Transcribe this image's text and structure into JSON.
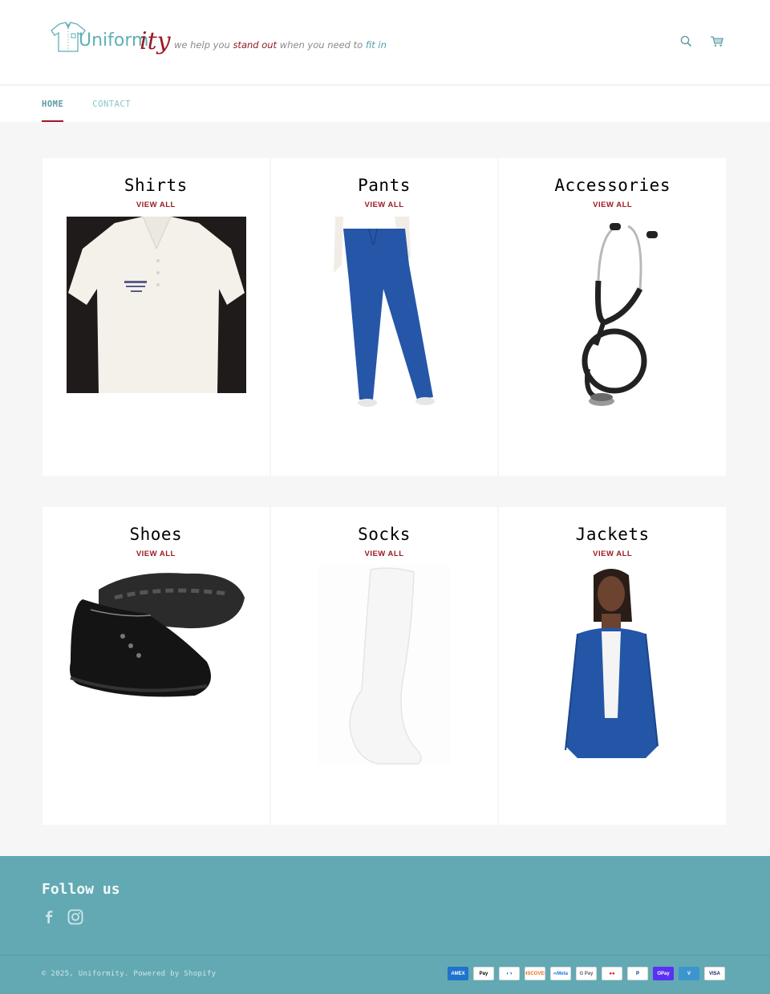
{
  "header": {
    "logo": {
      "word": "Uniform",
      "word_suffix": "ity",
      "tagline_parts": [
        "we help you ",
        "stand out",
        " when you need to ",
        "fit in"
      ]
    },
    "icons": {
      "search": "search-icon",
      "cart": "cart-icon"
    }
  },
  "nav": {
    "items": [
      {
        "label": "HOME",
        "active": true
      },
      {
        "label": "CONTACT",
        "active": false
      }
    ]
  },
  "collections": [
    {
      "title": "Shirts",
      "link_label": "VIEW ALL",
      "image": "white polo shirt"
    },
    {
      "title": "Pants",
      "link_label": "VIEW ALL",
      "image": "royal blue scrub pants"
    },
    {
      "title": "Accessories",
      "link_label": "VIEW ALL",
      "image": "black stethoscope"
    },
    {
      "title": "Shoes",
      "link_label": "VIEW ALL",
      "image": "black leather nursing shoes"
    },
    {
      "title": "Socks",
      "link_label": "VIEW ALL",
      "image": "white compression sock"
    },
    {
      "title": "Jackets",
      "link_label": "VIEW ALL",
      "image": "royal blue scrub jacket"
    }
  ],
  "footer": {
    "title": "Follow us",
    "social": [
      "facebook-icon",
      "instagram-icon"
    ],
    "copyright": "© 2025, Uniformity. Powered by Shopify",
    "payments": [
      {
        "name": "American Express",
        "label": "AMEX",
        "bg": "#1f72cd",
        "fg": "#ffffff"
      },
      {
        "name": "Apple Pay",
        "label": " Pay",
        "bg": "#ffffff",
        "fg": "#000000"
      },
      {
        "name": "Diners Club",
        "label": "◐◑",
        "bg": "#ffffff",
        "fg": "#0079be"
      },
      {
        "name": "Discover",
        "label": "DISCOVER",
        "bg": "#ffffff",
        "fg": "#e96c1f"
      },
      {
        "name": "Meta Pay",
        "label": "∞Meta",
        "bg": "#ffffff",
        "fg": "#1877f2"
      },
      {
        "name": "Google Pay",
        "label": "G Pay",
        "bg": "#ffffff",
        "fg": "#5f6368"
      },
      {
        "name": "Mastercard",
        "label": "●●",
        "bg": "#ffffff",
        "fg": "#eb001b"
      },
      {
        "name": "PayPal",
        "label": "P",
        "bg": "#ffffff",
        "fg": "#003087"
      },
      {
        "name": "Shop Pay",
        "label": "OPay",
        "bg": "#5a31f4",
        "fg": "#ffffff"
      },
      {
        "name": "Venmo",
        "label": "V",
        "bg": "#3d95ce",
        "fg": "#ffffff"
      },
      {
        "name": "Visa",
        "label": "VISA",
        "bg": "#ffffff",
        "fg": "#1a1f71"
      }
    ]
  },
  "colors": {
    "accent_red": "#9b1a24",
    "teal": "#62a9b3",
    "nav_active": "#5b9aa4",
    "nav_inactive": "#8cc3ca",
    "page_bg": "#f6f6f6"
  }
}
